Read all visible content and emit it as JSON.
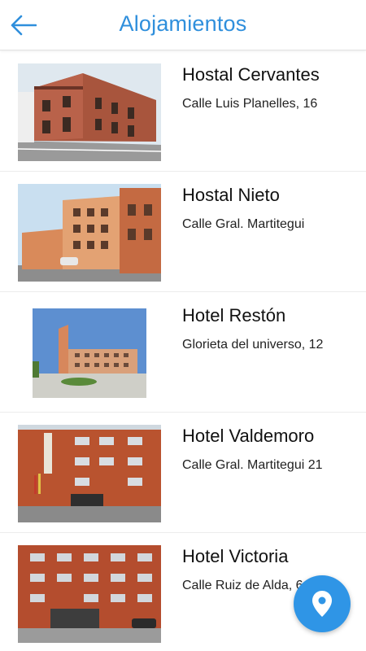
{
  "header": {
    "title": "Alojamientos",
    "back_icon": "arrow-left-icon",
    "accent_color": "#2f8fdc"
  },
  "accommodations": [
    {
      "name": "Hostal Cervantes",
      "address": "Calle Luis Planelles, 16"
    },
    {
      "name": "Hostal Nieto",
      "address": "Calle Gral. Martitegui"
    },
    {
      "name": "Hotel Restón",
      "address": "Glorieta del universo, 12"
    },
    {
      "name": "Hotel Valdemoro",
      "address": "Calle Gral. Martitegui 21"
    },
    {
      "name": "Hotel Victoria",
      "address": "Calle Ruiz de Alda, 6"
    }
  ],
  "fab": {
    "icon": "map-pin-icon",
    "color": "#2f95e6"
  }
}
